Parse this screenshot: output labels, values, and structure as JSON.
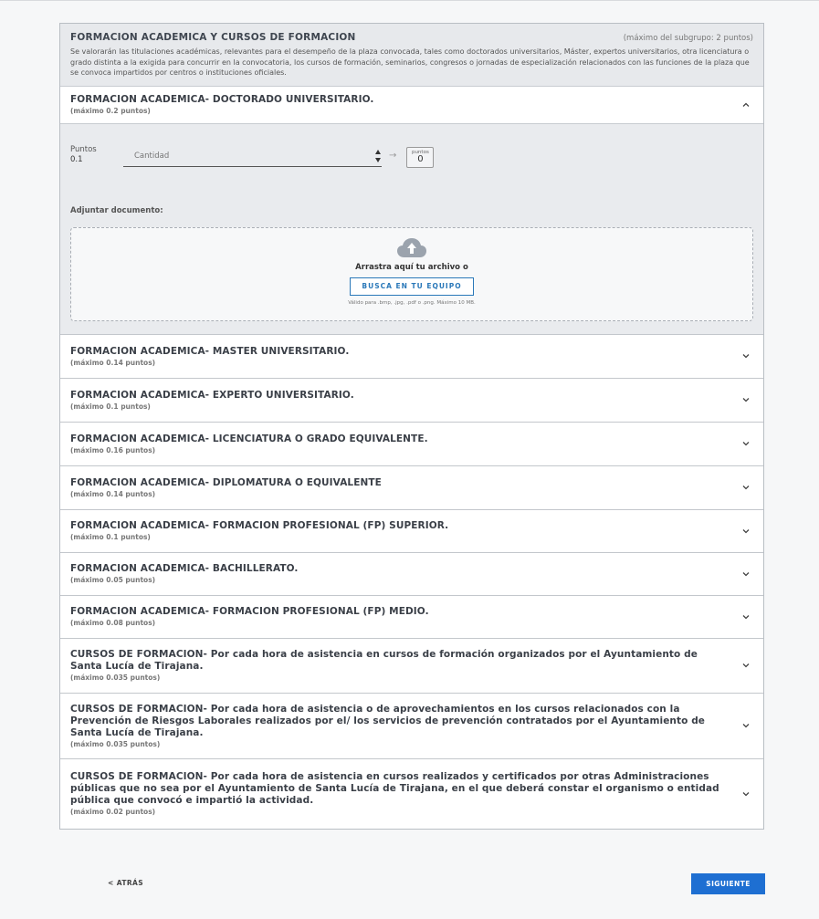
{
  "section": {
    "title": "FORMACION ACADEMICA Y CURSOS DE FORMACION",
    "max": "(máximo del subgrupo: 2 puntos)",
    "description": "Se valorarán las titulaciones académicas, relevantes para el desempeño de la plaza convocada, tales como doctorados universitarios, Máster, expertos universitarios, otra licenciatura o grado distinta a la exigida para concurrir en la convocatoria, los cursos de formación, seminarios, congresos o jornadas de especialización relacionados con las funciones de la plaza que se convoca impartidos por centros o instituciones oficiales."
  },
  "expanded": {
    "title": "FORMACION ACADEMICA- DOCTORADO UNIVERSITARIO.",
    "max": "(máximo 0.2 puntos)",
    "points_label": "Puntos",
    "points_value": "0.1",
    "quantity_placeholder": "Cantidad",
    "arrow": "→",
    "result_label": "puntos",
    "result_value": "0",
    "attach_label": "Adjuntar documento:",
    "drop_text": "Arrastra aquí tu archivo o",
    "browse_label": "BUSCA EN TU EQUIPO",
    "valid_text": "Válido para .bmp, .jpg, .pdf o .png. Máximo 10 MB."
  },
  "items": [
    {
      "title": "FORMACION ACADEMICA- MASTER UNIVERSITARIO.",
      "max": "(máximo 0.14 puntos)"
    },
    {
      "title": "FORMACION ACADEMICA- EXPERTO UNIVERSITARIO.",
      "max": "(máximo 0.1 puntos)"
    },
    {
      "title": "FORMACION ACADEMICA- LICENCIATURA O GRADO EQUIVALENTE.",
      "max": "(máximo 0.16 puntos)"
    },
    {
      "title": "FORMACION ACADEMICA- DIPLOMATURA O EQUIVALENTE",
      "max": "(máximo 0.14 puntos)"
    },
    {
      "title": "FORMACION ACADEMICA- FORMACION PROFESIONAL (FP) SUPERIOR.",
      "max": "(máximo 0.1 puntos)"
    },
    {
      "title": "FORMACION ACADEMICA- BACHILLERATO.",
      "max": "(máximo 0.05 puntos)"
    },
    {
      "title": "FORMACION ACADEMICA- FORMACION PROFESIONAL (FP) MEDIO.",
      "max": "(máximo 0.08 puntos)"
    },
    {
      "title": "CURSOS DE FORMACION- Por cada hora de asistencia en cursos de formación organizados por el Ayuntamiento de Santa Lucía de Tirajana.",
      "max": "(máximo 0.035 puntos)"
    },
    {
      "title": "CURSOS DE FORMACION- Por cada hora de asistencia o de aprovechamientos en los cursos relacionados con la Prevención de Riesgos Laborales realizados por el/ los servicios de prevención contratados por el Ayuntamiento de Santa Lucía de Tirajana.",
      "max": "(máximo 0.035 puntos)"
    },
    {
      "title": "CURSOS DE FORMACION- Por cada hora de asistencia en cursos realizados y certificados por otras Administraciones públicas que no sea por el Ayuntamiento de Santa Lucía de Tirajana, en el que deberá constar el organismo o entidad pública que convocó e impartió la actividad.",
      "max": "(máximo 0.02 puntos)"
    }
  ],
  "nav": {
    "back_label": "< ATRÁS",
    "next_label": "SIGUIENTE"
  },
  "colors": {
    "primary": "#1e6fd2",
    "link": "#2a78b9"
  }
}
